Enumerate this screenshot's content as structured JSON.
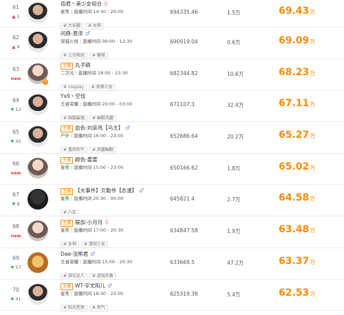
{
  "rows": [
    {
      "rank": "61",
      "change": "1",
      "change_dir": "up",
      "name": "佰君丶美少女组合",
      "gender": "f",
      "has_tag": false,
      "category": "星秀",
      "hours_label": "直播时间",
      "hours": "14:30 - 20:00",
      "tags": [
        "# 大长腿",
        "# 女神"
      ],
      "value1": "694335.46",
      "value2": "1.5万",
      "score": "69.43",
      "unit": "万",
      "avatar": "person"
    },
    {
      "rank": "62",
      "change": "9",
      "change_dir": "up",
      "name": "问鼎-恩泽",
      "gender": "m",
      "has_tag": false,
      "category": "穿越火线",
      "hours_label": "直播时间",
      "hours": "09:00 - 12:30",
      "tags": [
        "# 上分陪玩",
        "# 硬核"
      ],
      "value1": "690919.04",
      "value2": "0.6万",
      "score": "69.09",
      "unit": "万",
      "avatar": "person"
    },
    {
      "rank": "63",
      "change": "new",
      "change_dir": "new",
      "name": "丸子萌",
      "gender": "",
      "has_tag": true,
      "category": "二次元",
      "hours_label": "直播时间",
      "hours": "18:00 - 23:30",
      "tags": [
        "# cosplay",
        "# 呆萌少女"
      ],
      "value1": "682344.82",
      "value2": "10.6万",
      "score": "68.23",
      "unit": "万",
      "avatar": "girl",
      "vbadge": true
    },
    {
      "rank": "64",
      "change": "12",
      "change_dir": "down",
      "name": "Yx9丶空伐",
      "gender": "",
      "has_tag": false,
      "category": "王者荣耀",
      "hours_label": "直播时间",
      "hours": "20:00 - 03:00",
      "tags": [
        "# 国服最强",
        "# 幽默风趣"
      ],
      "value1": "671107.3",
      "value2": "32.4万",
      "score": "67.11",
      "unit": "万",
      "avatar": "person"
    },
    {
      "rank": "65",
      "change": "45",
      "change_dir": "down",
      "name": "血色-刘亲鸡【乌主】",
      "gender": "m",
      "has_tag": true,
      "category": "户外",
      "hours_label": "直播时间",
      "hours": "16:00 - 23:00",
      "tags": [
        "# 喜欢吹牛",
        "# 风趣幽默"
      ],
      "value1": "652686.64",
      "value2": "20.2万",
      "score": "65.27",
      "unit": "万",
      "avatar": "person"
    },
    {
      "rank": "66",
      "change": "new",
      "change_dir": "new",
      "name": "颜色-姜姜",
      "gender": "",
      "has_tag": true,
      "category": "星秀",
      "hours_label": "直播时间",
      "hours": "15:00 - 23:00",
      "tags": [],
      "value1": "650166.62",
      "value2": "1.8万",
      "score": "65.02",
      "unit": "万",
      "avatar": "girl"
    },
    {
      "rank": "67",
      "change": "8",
      "change_dir": "down",
      "name": "【大事件】贝勒爷【念漫】",
      "gender": "m",
      "has_tag": true,
      "category": "星秀",
      "hours_label": "直播时间",
      "hours": "20:30 - 00:00",
      "tags": [
        "# 八卦"
      ],
      "value1": "645821.4",
      "value2": "2.7万",
      "score": "64.58",
      "unit": "万",
      "avatar": "dark"
    },
    {
      "rank": "68",
      "change": "new",
      "change_dir": "new",
      "name": "娱加-小月月",
      "gender": "f",
      "has_tag": true,
      "category": "星秀",
      "hours_label": "直播时间",
      "hours": "17:00 - 20:30",
      "tags": [
        "# 女神",
        "# 清纯少女"
      ],
      "value1": "634847.58",
      "value2": "1.9万",
      "score": "63.48",
      "unit": "万",
      "avatar": "girl"
    },
    {
      "rank": "69",
      "change": "57",
      "change_dir": "down",
      "name": "Dae-浣熊君",
      "gender": "m",
      "has_tag": false,
      "category": "王者荣耀",
      "hours_label": "直播时间",
      "hours": "15:00 - 20:30",
      "tags": [
        "# 排位达人",
        "# 虚拟形象"
      ],
      "value1": "633669.5",
      "value2": "47.2万",
      "score": "63.37",
      "unit": "万",
      "avatar": "brown"
    },
    {
      "rank": "70",
      "change": "41",
      "change_dir": "down",
      "name": "WT-宇文阳儿",
      "gender": "m",
      "has_tag": true,
      "category": "星秀",
      "hours_label": "直播时间",
      "hours": "18:30 - 23:00",
      "tags": [
        "# 阳光型男",
        "# 帅气"
      ],
      "value1": "625319.38",
      "value2": "5.4万",
      "score": "62.53",
      "unit": "万",
      "avatar": "person"
    }
  ],
  "tag_label": "主播",
  "colors": {
    "accent": "#ff8a00",
    "up": "#e53935",
    "down": "#4caf50"
  }
}
